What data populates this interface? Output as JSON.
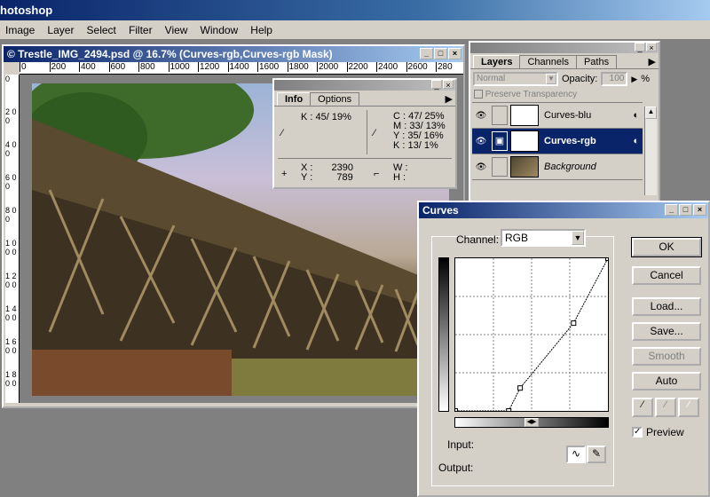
{
  "app": {
    "title": "hotoshop"
  },
  "menu": [
    "Image",
    "Layer",
    "Select",
    "Filter",
    "View",
    "Window",
    "Help"
  ],
  "doc": {
    "title": "© Trestle_IMG_2494.psd @ 16.7% (Curves-rgb,Curves-rgb Mask)",
    "ruler_ticks": [
      "0",
      "200",
      "400",
      "600",
      "800",
      "1000",
      "1200",
      "1400",
      "1600",
      "1800",
      "2000",
      "2200",
      "2400",
      "2600",
      "280"
    ],
    "vruler_ticks": [
      "0",
      "2 0 0",
      "4 0 0",
      "6 0 0",
      "8 0 0",
      "1 0 0 0",
      "1 2 0 0",
      "1 4 0 0",
      "1 6 0 0",
      "1 8 0 0"
    ]
  },
  "info": {
    "tabs": [
      "Info",
      "Options"
    ],
    "k_label": "K :",
    "k_value": "45/ 19%",
    "c_label": "C :",
    "c_value": "47/ 25%",
    "m_label": "M :",
    "m_value": "33/ 13%",
    "y_label": "Y :",
    "y_value": "35/ 16%",
    "k2_label": "K :",
    "k2_value": "13/  1%",
    "x_label": "X :",
    "x_value": "2390",
    "ycoord_label": "Y :",
    "ycoord_value": "789",
    "w_label": "W :",
    "h_label": "H :"
  },
  "layers": {
    "tabs": [
      "Layers",
      "Channels",
      "Paths"
    ],
    "blend_mode": "Normal",
    "opacity_label": "Opacity:",
    "opacity_value": "100",
    "opacity_unit": "%",
    "preserve_label": "Preserve Transparency",
    "items": [
      {
        "name": "Curves-blu",
        "selected": false
      },
      {
        "name": "Curves-rgb",
        "selected": true
      },
      {
        "name": "Background",
        "selected": false
      }
    ]
  },
  "curves": {
    "title": "Curves",
    "channel_label": "Channel:",
    "channel_value": "RGB",
    "input_label": "Input:",
    "output_label": "Output:",
    "buttons": {
      "ok": "OK",
      "cancel": "Cancel",
      "load": "Load...",
      "save": "Save...",
      "smooth": "Smooth",
      "auto": "Auto"
    },
    "preview_label": "Preview",
    "preview_checked": true,
    "curve_points": [
      [
        0,
        0
      ],
      [
        70,
        0
      ],
      [
        85,
        30
      ],
      [
        155,
        115
      ],
      [
        200,
        200
      ]
    ]
  }
}
